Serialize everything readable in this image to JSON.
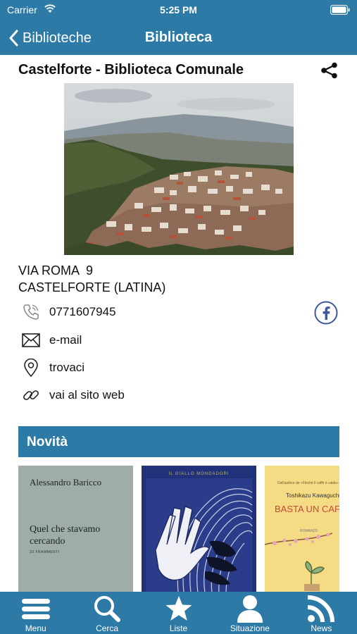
{
  "status_bar": {
    "carrier": "Carrier",
    "time": "5:25 PM"
  },
  "nav": {
    "back_label": "Biblioteche",
    "title": "Biblioteca"
  },
  "library": {
    "name": "Castelforte - Biblioteca Comunale",
    "photo_alt": "panorama",
    "address_line1": "VIA ROMA  9",
    "address_line2": "CASTELFORTE (LATINA)"
  },
  "contacts": {
    "phone": "0771607945",
    "email": "e-mail",
    "map": "trovaci",
    "website": "vai al sito web"
  },
  "novita": {
    "header": "Novità",
    "books": [
      {
        "author": "Alessandro Baricco",
        "title": "Quel che stavamo cercando",
        "series": "33 FRAMMENTI"
      },
      {
        "publisher": "IL GIALLO MONDADORI"
      },
      {
        "tagline": "Dall'autrice de «Finché il caffè è caldo»",
        "author": "Toshikazu Kawaguchi",
        "title": "BASTA UN CAFFÈ PER ESSERE FELICI",
        "genre": "ROMANZO"
      }
    ]
  },
  "tabs": [
    {
      "label": "Menu",
      "icon": "menu-icon"
    },
    {
      "label": "Cerca",
      "icon": "search-icon"
    },
    {
      "label": "Liste",
      "icon": "star-icon"
    },
    {
      "label": "Situazione",
      "icon": "user-icon"
    },
    {
      "label": "News",
      "icon": "rss-icon"
    }
  ],
  "colors": {
    "brand": "#2d7aa6",
    "facebook": "#3b5998"
  }
}
